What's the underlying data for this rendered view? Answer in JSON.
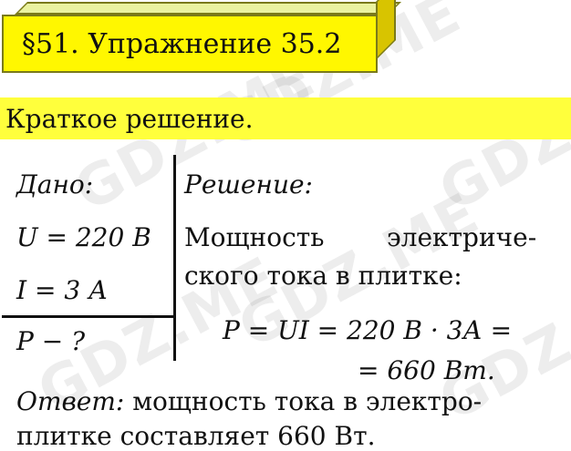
{
  "watermark": "GDZ.ME",
  "header": {
    "title": "§51. Упражнение 35.2"
  },
  "banner": {
    "text": "Краткое решение."
  },
  "given": {
    "label": "Дано:",
    "lines": [
      "U = 220 В",
      "I = 3 А"
    ],
    "find": "P − ?"
  },
  "solution": {
    "label": "Решение:",
    "line1_a": "Мощность",
    "line1_b": "электриче-",
    "line2": "ского тока в плитке:",
    "formula1": "P = UI = 220 В · 3А =",
    "formula2": "= 660 Вт."
  },
  "answer": {
    "label": "Ответ:",
    "line1": "мощность тока в электро-",
    "line2": "плитке составляет 660 Вт."
  }
}
